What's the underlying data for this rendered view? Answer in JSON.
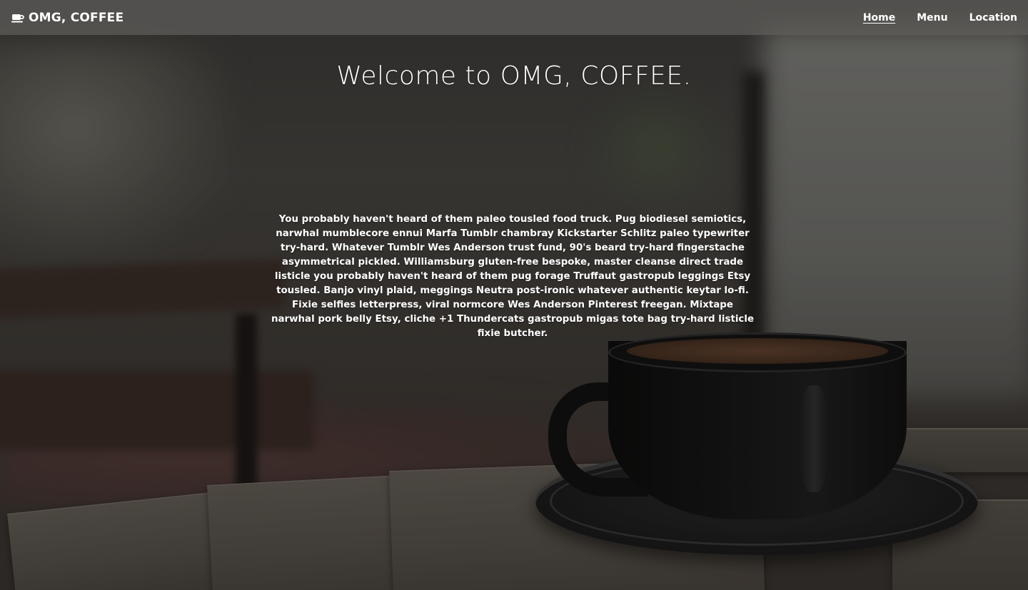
{
  "navbar": {
    "brand_icon": "coffee-cup-icon",
    "brand": "OMG, COFFEE",
    "links": [
      {
        "label": "Home",
        "active": true
      },
      {
        "label": "Menu",
        "active": false
      },
      {
        "label": "Location",
        "active": false
      }
    ]
  },
  "hero": {
    "title": "Welcome to OMG, COFFEE.",
    "body": "You probably haven't heard of them paleo tousled food truck. Pug biodiesel semiotics, narwhal mumblecore ennui Marfa Tumblr chambray Kickstarter Schlitz paleo typewriter try-hard. Whatever Tumblr Wes Anderson trust fund, 90's beard try-hard fingerstache asymmetrical pickled. Williamsburg gluten-free bespoke, master cleanse direct trade listicle you probably haven't heard of them pug forage Truffaut gastropub leggings Etsy tousled. Banjo vinyl plaid, meggings Neutra post-ironic whatever authentic keytar lo-fi. Fixie selfies letterpress, viral normcore Wes Anderson Pinterest freegan. Mixtape narwhal pork belly Etsy, cliche +1 Thundercats gastropub migas tote bag try-hard listicle fixie butcher."
  },
  "colors": {
    "navbar_bg": "#5f5e5c",
    "text": "#ffffff"
  }
}
